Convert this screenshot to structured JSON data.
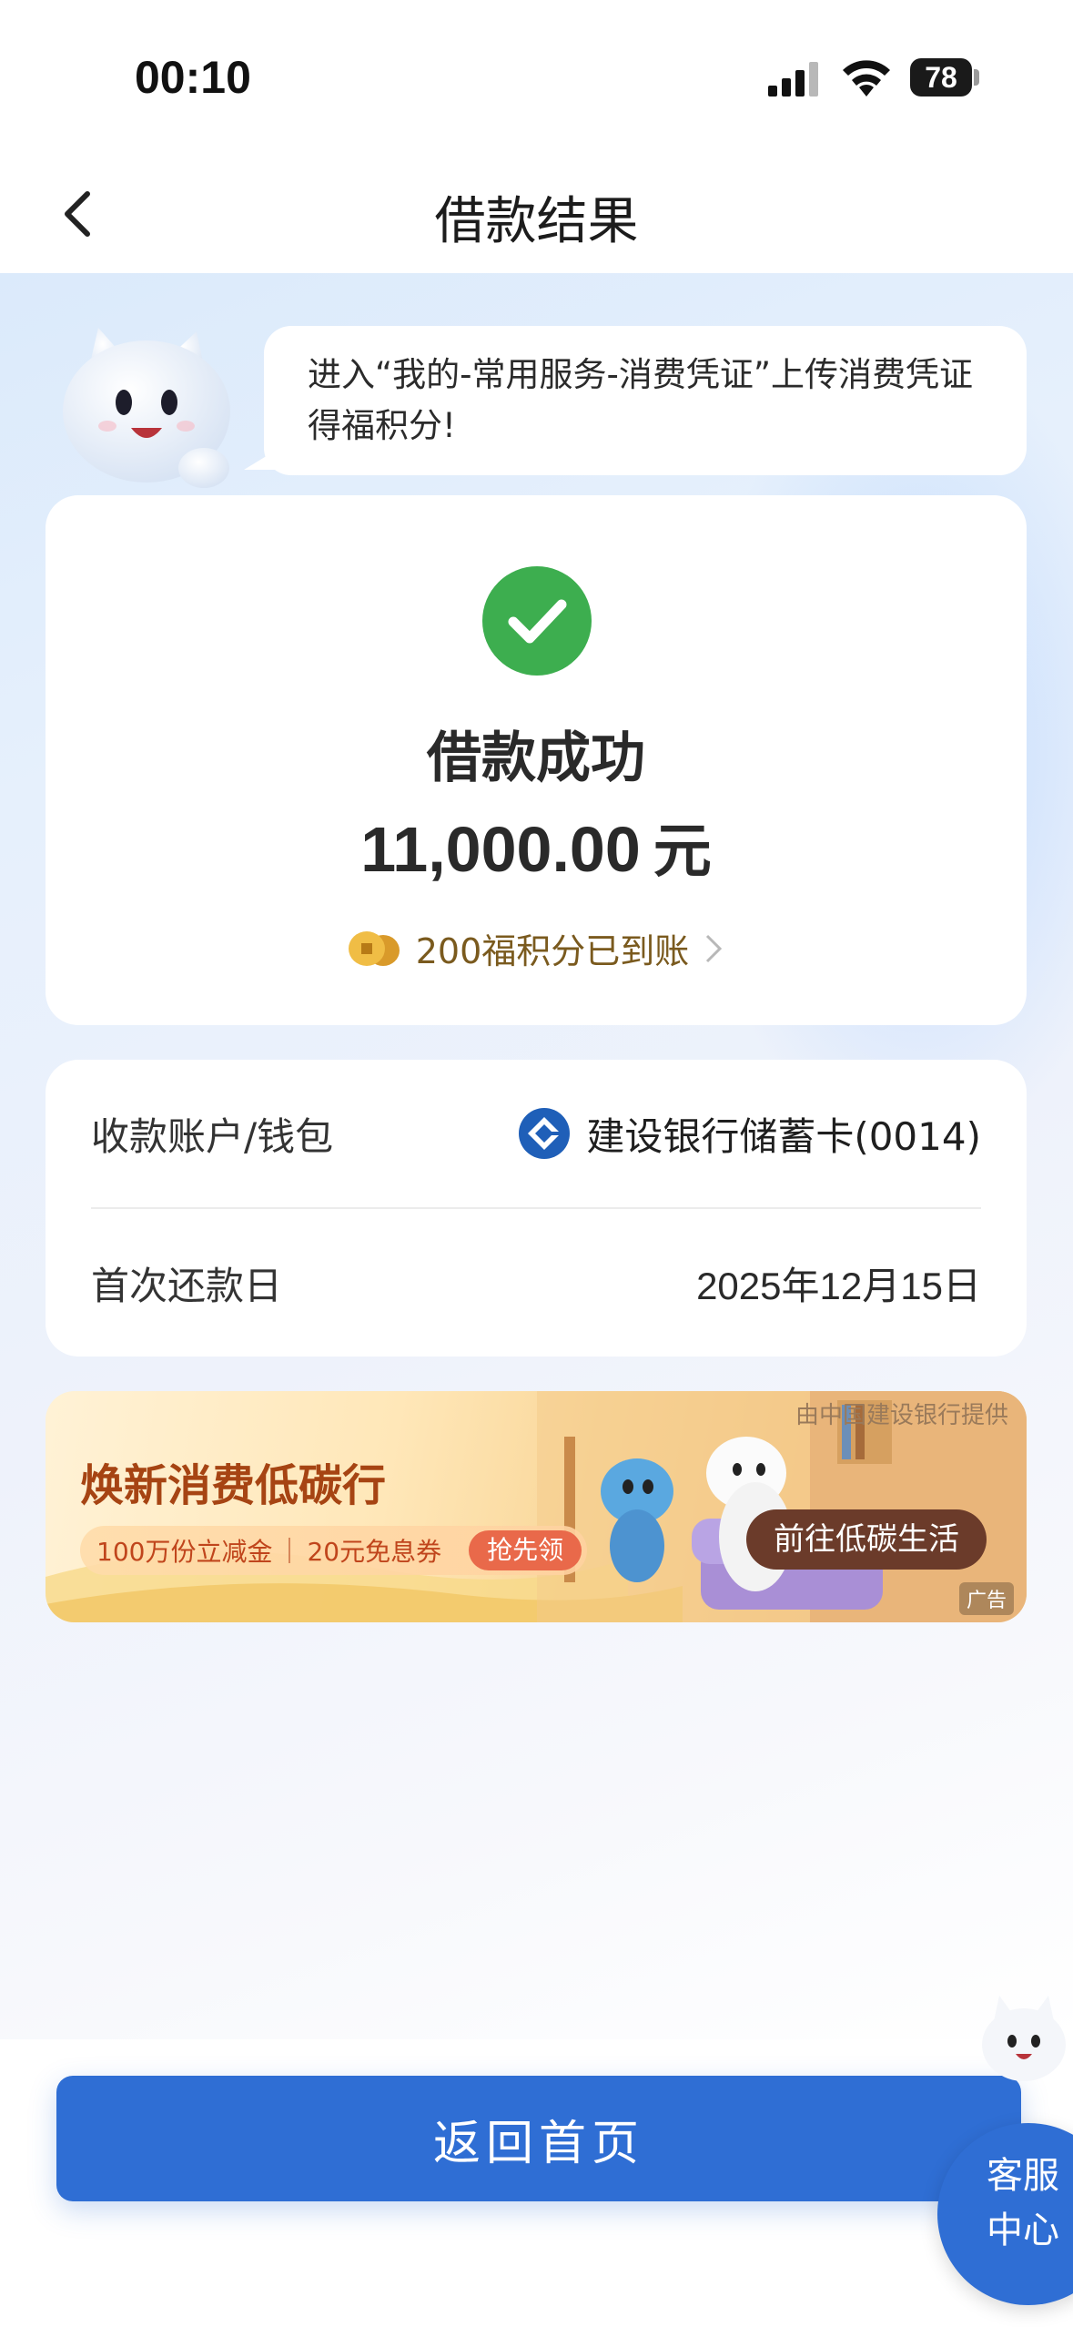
{
  "status_bar": {
    "time": "00:10",
    "battery": "78",
    "icons": [
      "signal-icon",
      "wifi-icon",
      "battery-icon"
    ]
  },
  "nav": {
    "title": "借款结果",
    "back_icon": "chevron-left-icon"
  },
  "tip": {
    "text": "进入“我的-常用服务-消费凭证”上传消费凭证得福积分!"
  },
  "result": {
    "status": "借款成功",
    "amount": "11,000.00",
    "unit": "元",
    "points_text": "200福积分已到账",
    "colors": {
      "success": "#3dae4f",
      "coin": "#e5a935"
    }
  },
  "info": {
    "rows": [
      {
        "label": "收款账户/钱包",
        "value": "建设银行储蓄卡(0014)"
      },
      {
        "label": "首次还款日",
        "value_num": "2025",
        "value_year": "年",
        "value_month_num": "12",
        "value_month": "月",
        "value_day_num": "15",
        "value_day": "日"
      }
    ]
  },
  "ad": {
    "sponsor": "由中国建设银行提供",
    "title": "焕新消费低碳行",
    "sub1": "100万份立减金",
    "sub2": "20元免息券",
    "grab": "抢先领",
    "cta": "前往低碳生活",
    "tag": "广告"
  },
  "bottom": {
    "home_button": "返回首页",
    "service_line1": "客服",
    "service_line2": "中心",
    "accent": "#2f6ed4"
  }
}
